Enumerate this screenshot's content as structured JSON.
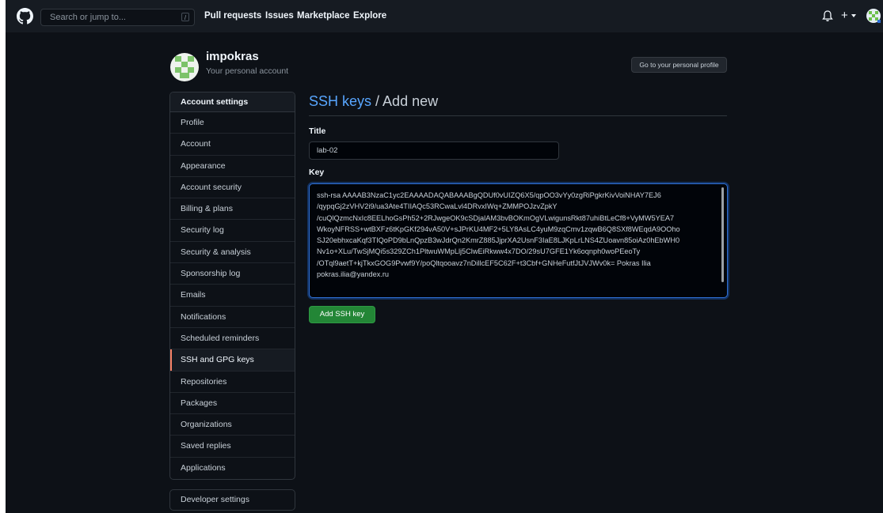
{
  "header": {
    "search_placeholder": "Search or jump to...",
    "search_shortcut": "/",
    "nav": [
      "Pull requests",
      "Issues",
      "Marketplace",
      "Explore"
    ],
    "plus_symbol": "+",
    "icons": [
      "github-logo-icon",
      "bell-icon",
      "plus-icon",
      "avatar-icon"
    ]
  },
  "account": {
    "username": "impokras",
    "subtitle": "Your personal account",
    "profile_button": "Go to your personal profile"
  },
  "sidebar": {
    "heading": "Account settings",
    "items": [
      {
        "label": "Profile"
      },
      {
        "label": "Account"
      },
      {
        "label": "Appearance"
      },
      {
        "label": "Account security"
      },
      {
        "label": "Billing & plans"
      },
      {
        "label": "Security log"
      },
      {
        "label": "Security & analysis"
      },
      {
        "label": "Sponsorship log"
      },
      {
        "label": "Emails"
      },
      {
        "label": "Notifications"
      },
      {
        "label": "Scheduled reminders"
      },
      {
        "label": "SSH and GPG keys",
        "selected": true
      },
      {
        "label": "Repositories"
      },
      {
        "label": "Packages"
      },
      {
        "label": "Organizations"
      },
      {
        "label": "Saved replies"
      },
      {
        "label": "Applications"
      }
    ],
    "developer_settings": "Developer settings"
  },
  "main": {
    "breadcrumb": "SSH keys",
    "separator": " / ",
    "page_title": "Add new",
    "title_label": "Title",
    "title_value": "lab-02",
    "key_label": "Key",
    "key_lines": [
      "ssh-rsa AAAAB3NzaC1yc2EAAAADAQABAAABgQDUf0vUIZQ6X5/qpOO3vYy0zgRiPgkrKivVoiNHAY7EJ6",
      "/qypqGj2zVHV2i9/ua3Ate4TIIAQc53RCwaLvl4DRvxIWq+ZMMPOJzvZpkY",
      "/cuQlQzmcNxIc8EELhoGsPh52+2RJwgeOK9cSDjalAM3bvBOKmOgVLwigunsRkt87uhiBtLeCf8+VyMW5YEA7",
      "WkoyNFRSS+wtBXFz6tKpGKf294vA50V+sJPrKU4MF2+5LY8AsLC4yuM9zqCmv1zqwB6Q8SXf8WEqdA9OOho",
      "SJ20ebhxcaKqf3TIQoPD9bLnQpzB3wJdrQn2KmrZ885JjprXA2UsnF3IaE8LJKpLrLNS4ZUoavn85oiAz0hEbWH0",
      "Nv1o+XLu/TwSjMQi5s329ZCh1PltwuWMpLlj5ClwEiRkww4x7DO/29sU7GFE1Yk6oqnph0woPEeoTy",
      "/OTql9aetT+kjTkxGOG9Pvwf9Y/poQltqooavz7nDillcEF5C62F+t3Cbf+GNHeFutfJtJVJWv0k= Pokras Ilia",
      "pokras.ilia@yandex.ru"
    ],
    "add_button": "Add SSH key"
  },
  "colors": {
    "background": "#0d1117",
    "header": "#161b22",
    "accent_link": "#58a6ff",
    "primary_button": "#238636",
    "selected_marker": "#f78166",
    "border": "#30363d"
  }
}
